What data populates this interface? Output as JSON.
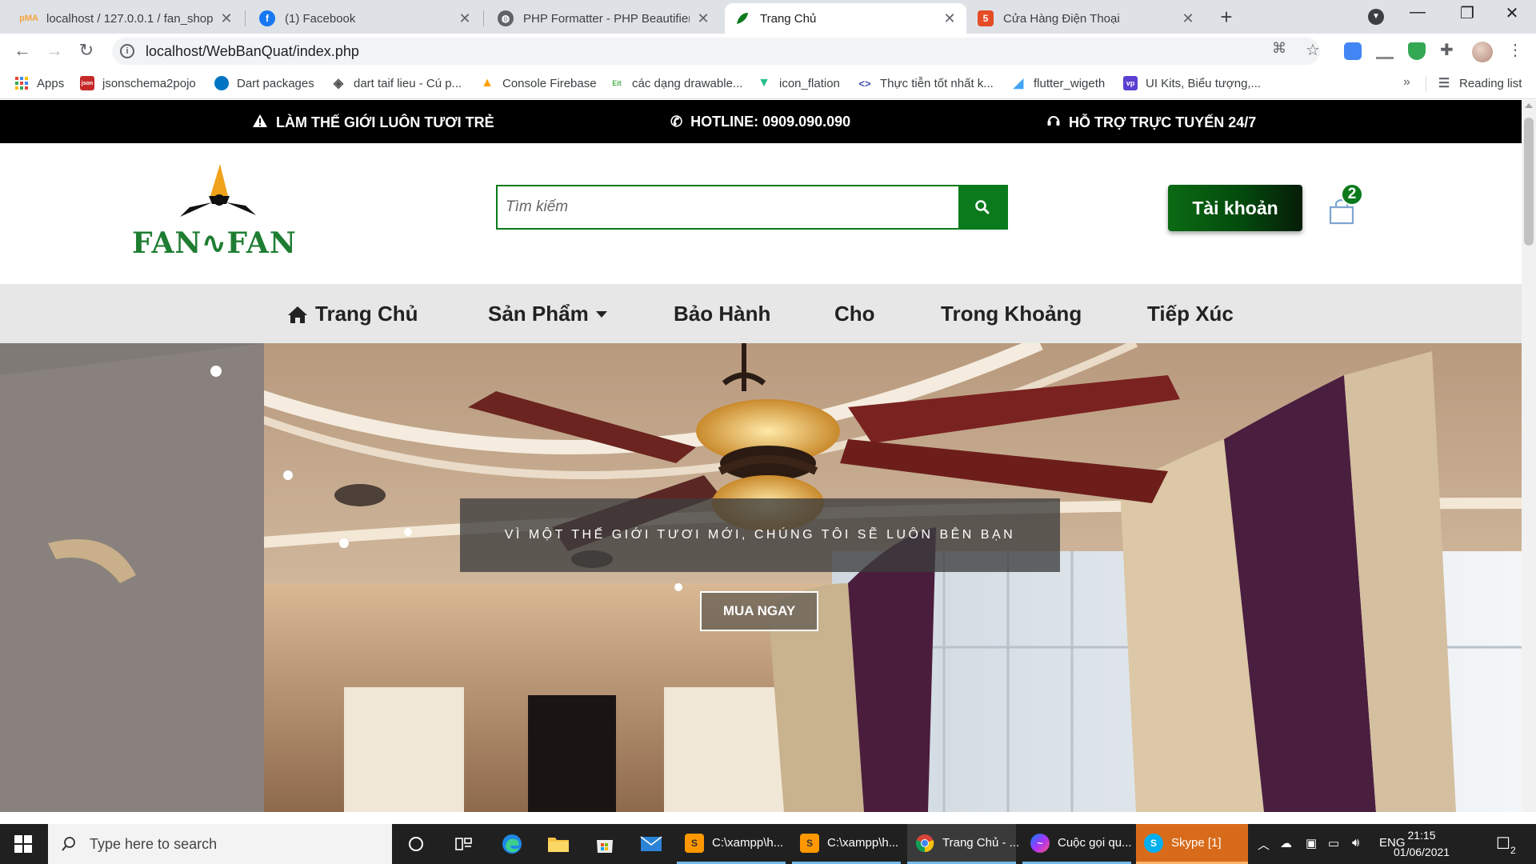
{
  "browser": {
    "tabs": [
      {
        "title": "localhost / 127.0.0.1 / fan_shop |",
        "icon": "phpmyadmin-icon",
        "color": "#f3a33a"
      },
      {
        "title": "(1) Facebook",
        "icon": "facebook-icon",
        "color": "#1877f2"
      },
      {
        "title": "PHP Formatter - PHP Beautifier -",
        "icon": "globe-icon",
        "color": "#5f6368"
      },
      {
        "title": "Trang Chủ",
        "icon": "leaf-icon",
        "color": "#0b7a1d",
        "active": true
      },
      {
        "title": "Cửa Hàng Điện Thoại",
        "icon": "html-icon",
        "color": "#e44d26"
      }
    ],
    "url": "localhost/WebBanQuat/index.php",
    "bookmarks": [
      {
        "label": "Apps",
        "icon": "apps-grid-icon"
      },
      {
        "label": "jsonschema2pojo",
        "icon": "json-icon"
      },
      {
        "label": "Dart packages",
        "icon": "dart-icon"
      },
      {
        "label": "dart taif lieu - Cú p...",
        "icon": "diamond-icon"
      },
      {
        "label": "Console Firebase",
        "icon": "firebase-icon"
      },
      {
        "label": "các dạng drawable...",
        "icon": "eit-icon"
      },
      {
        "label": "icon_flation",
        "icon": "v-icon"
      },
      {
        "label": "Thực tiễn tốt nhất k...",
        "icon": "code-icon"
      },
      {
        "label": "flutter_wigeth",
        "icon": "flutter-icon"
      },
      {
        "label": "UI Kits, Biểu tượng,...",
        "icon": "vp-icon"
      }
    ],
    "reading_list": "Reading list"
  },
  "site": {
    "topbar": {
      "slogan": "LÀM THẾ GIỚI LUÔN TƯƠI TRẺ",
      "hotline": "HOTLINE: 0909.090.090",
      "support": "HỖ TRỢ TRỰC TUYẾN 24/7"
    },
    "logo_text": "FAN∿FAN",
    "search_placeholder": "Tìm kiếm",
    "account_label": "Tài khoản",
    "cart_count": "2",
    "nav": [
      "Trang Chủ",
      "Sản Phẩm",
      "Bảo Hành",
      "Cho",
      "Trong Khoảng",
      "Tiếp Xúc"
    ],
    "hero": {
      "caption": "VÌ MỘT THẾ GIỚI TƯƠI MỚI, CHÚNG TÔI SẼ LUÔN BÊN BẠN",
      "cta": "MUA NGAY"
    },
    "colors": {
      "brand_green": "#0b7a1d",
      "topbar_bg": "#000000",
      "nav_bg": "#e7e7e7"
    }
  },
  "taskbar": {
    "search_placeholder": "Type here to search",
    "apps": [
      {
        "label": "C:\\xampp\\h...",
        "icon": "sublime-icon"
      },
      {
        "label": "C:\\xampp\\h...",
        "icon": "sublime-icon"
      },
      {
        "label": "Trang Chủ - ...",
        "icon": "chrome-icon"
      },
      {
        "label": "Cuộc gọi qu...",
        "icon": "messenger-icon"
      },
      {
        "label": "Skype [1]",
        "icon": "skype-icon"
      }
    ],
    "language": "ENG",
    "time": "21:15",
    "date": "01/06/2021",
    "notifications": "2"
  }
}
